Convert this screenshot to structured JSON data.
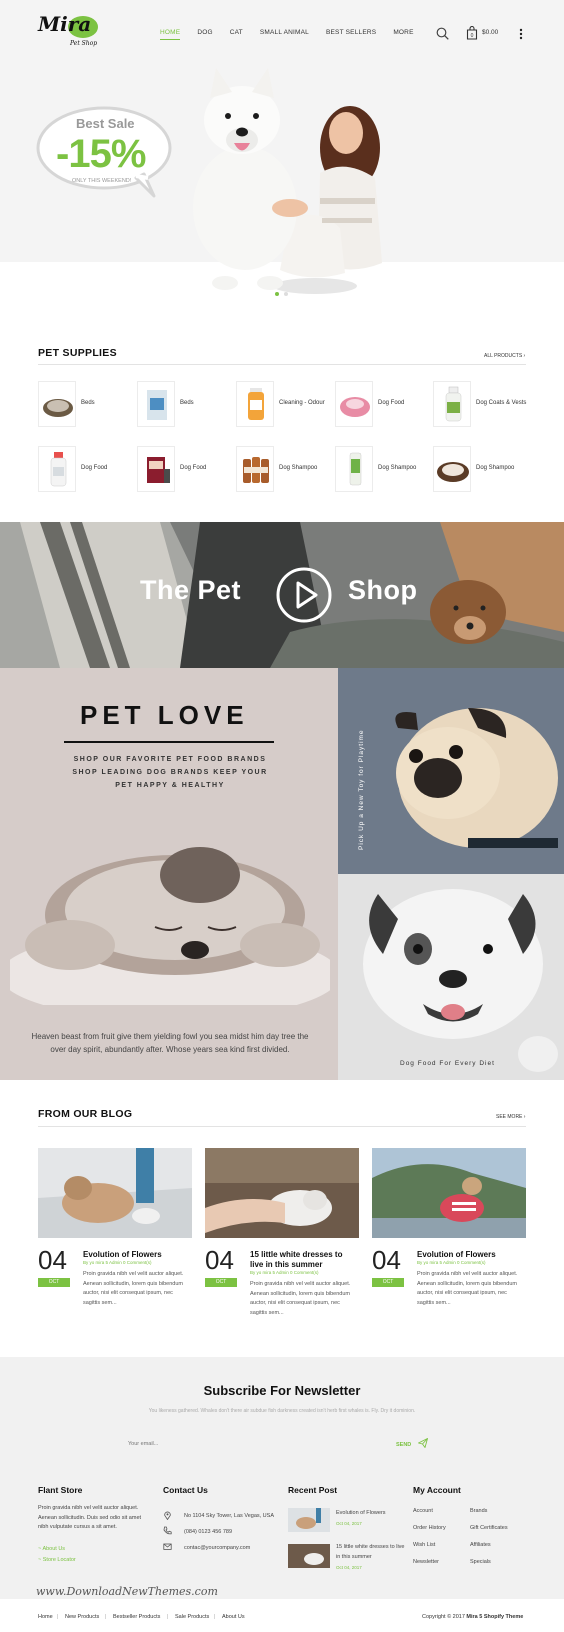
{
  "brand": {
    "logo_text": "Mira",
    "logo_sub": "Pet Shop"
  },
  "nav": {
    "items": [
      "HOME",
      "DOG",
      "CAT",
      "SMALL ANIMAL",
      "BEST SELLERS",
      "MORE"
    ],
    "cart_total": "$0.00"
  },
  "hero": {
    "badge_title": "Best Sale",
    "badge_value": "-15%",
    "badge_note": "ONLY THIS WEEKEND!",
    "slides": 2,
    "active_slide": 1
  },
  "supplies": {
    "title": "PET SUPPLIES",
    "link": "ALL PRODUCTS",
    "products": [
      {
        "label": "Beds",
        "thumb": "bed"
      },
      {
        "label": "Beds",
        "thumb": "bag"
      },
      {
        "label": "Cleaning - Odour",
        "thumb": "bottle-orange"
      },
      {
        "label": "Dog Food",
        "thumb": "bowl-pink"
      },
      {
        "label": "Dog Coats & Vests",
        "thumb": "spray-green"
      },
      {
        "label": "Dog Food",
        "thumb": "spray-white"
      },
      {
        "label": "Dog Food",
        "thumb": "box-red"
      },
      {
        "label": "Dog Shampoo",
        "thumb": "bottles-brown"
      },
      {
        "label": "Dog Shampoo",
        "thumb": "tube-green"
      },
      {
        "label": "Dog Shampoo",
        "thumb": "bed-brown"
      }
    ]
  },
  "video": {
    "left": "The Pet",
    "right": "Shop"
  },
  "love": {
    "title": "PET LOVE",
    "subtitle_lines": [
      "SHOP OUR FAVORITE PET FOOD BRANDS",
      "SHOP LEADING DOG BRANDS KEEP YOUR",
      "PET HAPPY & HEALTHY"
    ],
    "caption": "Heaven beast from fruit give them yielding fowl you sea midst him day tree the over day spirit, abundantly after. Whose years sea kind first divided.",
    "pug_text": "Pick Up a New Toy for Playtime",
    "bulldog_text": "Dog Food For Every Diet"
  },
  "blog": {
    "title": "FROM OUR BLOG",
    "link": "SEE MORE",
    "posts": [
      {
        "day": "04",
        "month": "OCT",
        "title": "Evolution of Flowers",
        "meta": "By yo mira 5 Admin    0 Comment(s)",
        "excerpt": "Proin gravida nibh vel velit auctor aliquet. Aenean sollicitudin, lorem quis bibendum auctor, nisi elit consequat ipsum, nec sagittis sem..."
      },
      {
        "day": "04",
        "month": "OCT",
        "title": "15 little white dresses to live in this summer",
        "meta": "By yo mira 5 Admin    0 Comment(s)",
        "excerpt": "Proin gravida nibh vel velit auctor aliquet. Aenean sollicitudin, lorem quis bibendum auctor, nisi elit consequat ipsum, nec sagittis sem..."
      },
      {
        "day": "04",
        "month": "OCT",
        "title": "Evolution of Flowers",
        "meta": "By yo mira 5 Admin    0 Comment(s)",
        "excerpt": "Proin gravida nibh vel velit auctor aliquet. Aenean sollicitudin, lorem quis bibendum auctor, nisi elit consequat ipsum, nec sagittis sem..."
      }
    ]
  },
  "newsletter": {
    "title": "Subscribe For Newsletter",
    "subtitle": "You likeness gathered. Whales don't there air subdue fish darkness created isn't herb first whales is. Fly. Dry it dominion.",
    "placeholder": "Your email...",
    "send": "SEND"
  },
  "footer": {
    "store": {
      "title": "Flant Store",
      "text": "Proin gravida nibh vel velit auctor aliquet. Aenean sollicitudin. Duis sed odio sit amet nibh vulputate cursus a sit amet.",
      "links": [
        "About Us",
        "Store Locator"
      ]
    },
    "contact": {
      "title": "Contact Us",
      "address": "No 1104 Sky Tower, Las Vegas, USA",
      "phone": "(084) 0123 456 789",
      "email": "contac@yourcompany.com"
    },
    "recent": {
      "title": "Recent Post",
      "posts": [
        {
          "title": "Evolution of Flowers",
          "date": "Oct 04, 2017"
        },
        {
          "title": "15 little white dresses to live in this summer",
          "date": "Oct 04, 2017"
        }
      ]
    },
    "account": {
      "title": "My Account",
      "col1": [
        "Account",
        "Order History",
        "Wish List",
        "Newsletter"
      ],
      "col2": [
        "Brands",
        "Gift Certificates",
        "Affiliates",
        "Specials"
      ]
    }
  },
  "watermark": "www.DownloadNewThemes.com",
  "bottom": {
    "links": [
      "Home",
      "New Products",
      "Bestseller Products",
      "Sale Products",
      "About Us"
    ],
    "copyright_prefix": "Copyright © 2017",
    "copyright_brand": "Mira 5 Shopify Theme"
  },
  "colors": {
    "accent": "#7cc242",
    "love_bg": "#d6ccc9"
  }
}
